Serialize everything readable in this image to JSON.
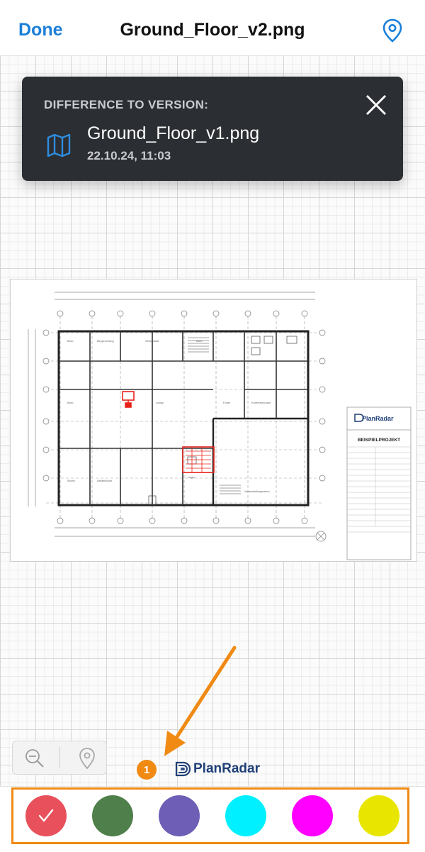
{
  "header": {
    "done_label": "Done",
    "title": "Ground_Floor_v2.png",
    "pin_icon": "location-pin-icon"
  },
  "version_popup": {
    "label": "DIFFERENCE TO VERSION:",
    "file_name": "Ground_Floor_v1.png",
    "date": "22.10.24, 11:03",
    "icon": "map-icon",
    "close_icon": "close-icon"
  },
  "plan": {
    "title_block": {
      "brand": "PlanRadar",
      "project": "BEISPIELPROJEKT"
    },
    "highlight_color": "#e8221b"
  },
  "zoom": {
    "zoom_out_icon": "zoom-out-icon",
    "pin_icon": "location-pin-icon"
  },
  "annotation": {
    "step": "1",
    "color": "#f08a13"
  },
  "brand": {
    "name": "PlanRadar",
    "color": "#1f3f78"
  },
  "palette": {
    "selected": 0,
    "colors": [
      "#e8505b",
      "#4f7f4a",
      "#6e5eb6",
      "#00f0ff",
      "#ff00ff",
      "#e8e600"
    ]
  }
}
